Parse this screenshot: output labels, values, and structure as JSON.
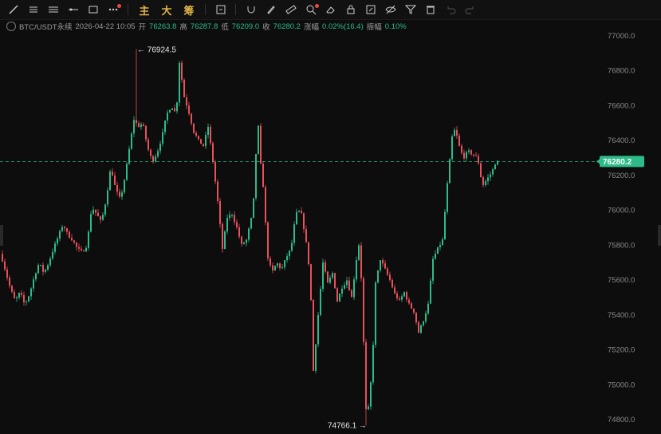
{
  "toolbar": {
    "tools": [
      {
        "name": "trend-line-icon"
      },
      {
        "name": "multi-line-icon"
      },
      {
        "name": "channel-icon"
      },
      {
        "name": "horizontal-ray-icon"
      },
      {
        "name": "rectangle-icon"
      },
      {
        "name": "more-shapes-icon"
      }
    ],
    "indicator_labels": [
      "主",
      "大",
      "筹"
    ],
    "actions": [
      {
        "name": "screenshot-icon"
      },
      {
        "name": "magnet-icon"
      },
      {
        "name": "brush-icon"
      },
      {
        "name": "ruler-icon"
      },
      {
        "name": "zoom-icon"
      },
      {
        "name": "eraser-icon"
      },
      {
        "name": "lock-icon"
      },
      {
        "name": "edit-icon"
      },
      {
        "name": "hide-icon"
      },
      {
        "name": "filter-icon"
      },
      {
        "name": "delete-icon"
      },
      {
        "name": "undo-icon"
      },
      {
        "name": "redo-icon"
      }
    ]
  },
  "info": {
    "symbol": "BTC/USDT永续",
    "datetime": "2026-04-22 10:05",
    "open_label": "开",
    "open": "76263.8",
    "high_label": "高",
    "high": "76287.8",
    "low_label": "低",
    "low": "76209.0",
    "close_label": "收",
    "close": "76280.2",
    "change_label": "涨幅",
    "change": "0.02%(16.4)",
    "amplitude_label": "振幅",
    "amplitude": "0.10%"
  },
  "colors": {
    "up": "#2dbb89",
    "down": "#e8505b",
    "background": "#0d0d0d",
    "axis_text": "#8a8a8a",
    "price_tag": "#2dbb89"
  },
  "chart_data": {
    "type": "candlestick",
    "ylim": [
      74700,
      77100
    ],
    "y_ticks": [
      "77000.0",
      "76800.0",
      "76600.0",
      "76400.0",
      "76200.0",
      "76000.0",
      "75800.0",
      "75600.0",
      "75400.0",
      "75200.0",
      "75000.0",
      "74800.0"
    ],
    "current_price": "76280.2",
    "high_annotation": "← 76924.5",
    "low_annotation": "74766.1 →",
    "highest": 76924.5,
    "lowest": 74766.1,
    "path": [
      [
        0,
        75750
      ],
      [
        6,
        75650
      ],
      [
        12,
        75550
      ],
      [
        18,
        75480
      ],
      [
        24,
        75530
      ],
      [
        30,
        75460
      ],
      [
        36,
        75520
      ],
      [
        42,
        75620
      ],
      [
        48,
        75700
      ],
      [
        54,
        75640
      ],
      [
        60,
        75700
      ],
      [
        66,
        75780
      ],
      [
        72,
        75850
      ],
      [
        78,
        75920
      ],
      [
        84,
        75860
      ],
      [
        90,
        75830
      ],
      [
        96,
        75780
      ],
      [
        102,
        75760
      ],
      [
        108,
        75800
      ],
      [
        114,
        76020
      ],
      [
        120,
        75980
      ],
      [
        126,
        75930
      ],
      [
        132,
        76060
      ],
      [
        138,
        76250
      ],
      [
        144,
        76120
      ],
      [
        150,
        76060
      ],
      [
        156,
        76200
      ],
      [
        162,
        76380
      ],
      [
        168,
        76550
      ],
      [
        170,
        76924.5
      ],
      [
        172,
        76480
      ],
      [
        178,
        76500
      ],
      [
        184,
        76360
      ],
      [
        190,
        76280
      ],
      [
        196,
        76330
      ],
      [
        202,
        76420
      ],
      [
        208,
        76550
      ],
      [
        214,
        76600
      ],
      [
        220,
        76550
      ],
      [
        224,
        76850
      ],
      [
        230,
        76650
      ],
      [
        236,
        76560
      ],
      [
        242,
        76450
      ],
      [
        248,
        76400
      ],
      [
        254,
        76370
      ],
      [
        260,
        76480
      ],
      [
        266,
        76280
      ],
      [
        272,
        76050
      ],
      [
        278,
        75780
      ],
      [
        284,
        75960
      ],
      [
        290,
        75980
      ],
      [
        296,
        75900
      ],
      [
        302,
        75800
      ],
      [
        308,
        75830
      ],
      [
        314,
        75950
      ],
      [
        318,
        76100
      ],
      [
        322,
        76550
      ],
      [
        326,
        76260
      ],
      [
        330,
        76100
      ],
      [
        334,
        75750
      ],
      [
        340,
        75640
      ],
      [
        346,
        75700
      ],
      [
        352,
        75660
      ],
      [
        358,
        75730
      ],
      [
        364,
        75780
      ],
      [
        370,
        75980
      ],
      [
        376,
        76000
      ],
      [
        382,
        75850
      ],
      [
        388,
        75620
      ],
      [
        392,
        75080
      ],
      [
        398,
        75400
      ],
      [
        404,
        75700
      ],
      [
        410,
        75580
      ],
      [
        416,
        75640
      ],
      [
        422,
        75480
      ],
      [
        428,
        75560
      ],
      [
        434,
        75600
      ],
      [
        440,
        75500
      ],
      [
        446,
        75720
      ],
      [
        450,
        75830
      ],
      [
        454,
        75400
      ],
      [
        458,
        74766.1
      ],
      [
        462,
        74900
      ],
      [
        466,
        75120
      ],
      [
        470,
        75580
      ],
      [
        476,
        75720
      ],
      [
        482,
        75660
      ],
      [
        488,
        75600
      ],
      [
        494,
        75520
      ],
      [
        500,
        75480
      ],
      [
        506,
        75530
      ],
      [
        512,
        75460
      ],
      [
        518,
        75420
      ],
      [
        524,
        75300
      ],
      [
        530,
        75370
      ],
      [
        536,
        75460
      ],
      [
        542,
        75720
      ],
      [
        548,
        75780
      ],
      [
        554,
        75830
      ],
      [
        560,
        76150
      ],
      [
        566,
        76420
      ],
      [
        570,
        76470
      ],
      [
        574,
        76380
      ],
      [
        580,
        76300
      ],
      [
        586,
        76340
      ],
      [
        592,
        76320
      ],
      [
        598,
        76300
      ],
      [
        604,
        76140
      ],
      [
        610,
        76180
      ],
      [
        616,
        76220
      ],
      [
        620,
        76270
      ],
      [
        624,
        76280.2
      ]
    ]
  }
}
